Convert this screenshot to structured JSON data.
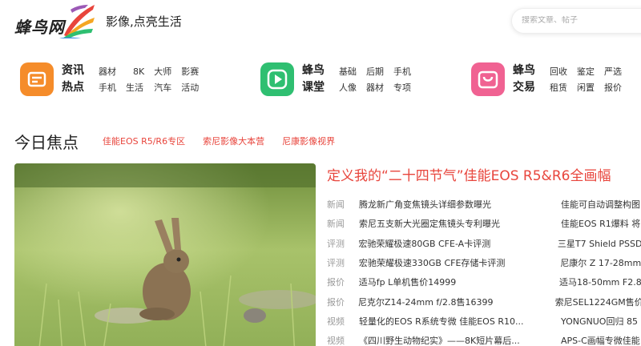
{
  "header": {
    "logo_text": "蜂鸟网",
    "slogan": "影像,点亮生活",
    "search_placeholder": "搜索文章、帖子"
  },
  "nav": [
    {
      "title_line1": "资讯",
      "title_line2": "热点",
      "color": "#f58c2a",
      "links": [
        "器材",
        "8K",
        "大师",
        "影赛",
        "手机",
        "生活",
        "汽车",
        "活动"
      ]
    },
    {
      "title_line1": "蜂鸟",
      "title_line2": "课堂",
      "color": "#2fbf71",
      "links": [
        "基础",
        "后期",
        "手机",
        "人像",
        "器材",
        "专项"
      ]
    },
    {
      "title_line1": "蜂鸟",
      "title_line2": "交易",
      "color": "#f06292",
      "links": [
        "回收",
        "鉴定",
        "严选",
        "租赁",
        "闲置",
        "报价"
      ]
    }
  ],
  "focus": {
    "title": "今日焦点",
    "links": [
      "佳能EOS R5/R6专区",
      "索尼影像大本营",
      "尼康影像视界"
    ]
  },
  "headline": "定义我的“二十四节气”佳能EOS R5&R6全画幅",
  "news": [
    {
      "cat": "新闻",
      "title": "腾龙新广角变焦镜头详细参数曝光",
      "side": "佳能可自动调整构图"
    },
    {
      "cat": "新闻",
      "title": "索尼五支新大光圈定焦镜头专利曝光",
      "side": "佳能EOS R1爆料 将"
    },
    {
      "cat": "评测",
      "title": "宏驰荣耀极速80GB CFE-A卡评测",
      "side": "三星T7 Shield PSSD"
    },
    {
      "cat": "评测",
      "title": "宏驰荣耀极速330GB CFE存储卡评测",
      "side": "尼康尔 Z 17-28mm"
    },
    {
      "cat": "报价",
      "title": "适马fp L单机售价14999",
      "side": "适马18-50mm F2.8"
    },
    {
      "cat": "报价",
      "title": "尼克尔Z14-24mm f/2.8售16399",
      "side": "索尼SEL1224GM售价"
    },
    {
      "cat": "视频",
      "title": "轻量化的EOS R系统专微 佳能EOS R10...",
      "side": "YONGNUO回归 85"
    },
    {
      "cat": "视频",
      "title": "《四川野生动物纪实》——8K短片幕后...",
      "side": "APS-C画幅专微佳能"
    }
  ]
}
